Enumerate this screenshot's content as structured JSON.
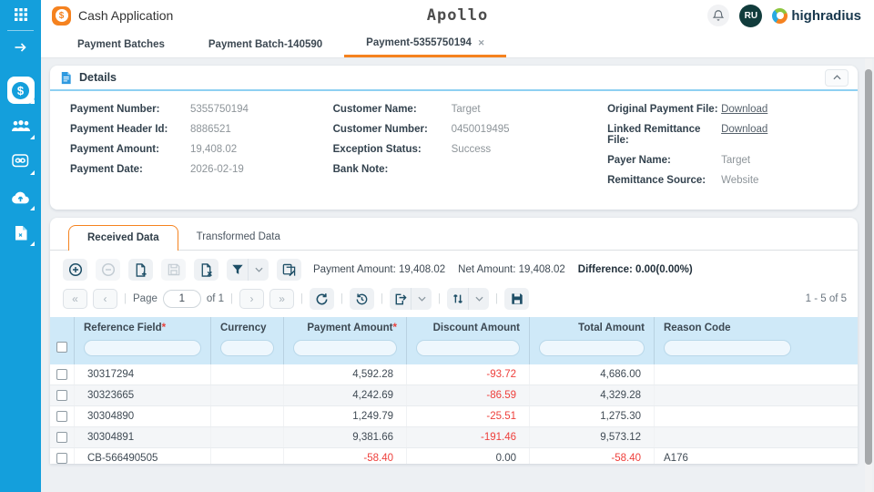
{
  "header": {
    "app_title": "Cash Application",
    "badge_glyph": "$",
    "brand": "Apollo",
    "avatar_initials": "RU",
    "logo_text": "highradius"
  },
  "nav_tabs": {
    "items": [
      {
        "label": "Payment Batches"
      },
      {
        "label": "Payment Batch-140590"
      },
      {
        "label": "Payment-5355750194"
      }
    ],
    "close_glyph": "✕"
  },
  "details": {
    "title": "Details",
    "col1": [
      {
        "label": "Payment Number:",
        "value": "5355750194"
      },
      {
        "label": "Payment Header Id:",
        "value": "8886521"
      },
      {
        "label": "Payment Amount:",
        "value": "19,408.02"
      },
      {
        "label": "Payment Date:",
        "value": "2026-02-19"
      }
    ],
    "col2": [
      {
        "label": "Customer Name:",
        "value": "Target"
      },
      {
        "label": "Customer Number:",
        "value": "0450019495"
      },
      {
        "label": "Exception Status:",
        "value": "Success"
      },
      {
        "label": "Bank Note:",
        "value": ""
      }
    ],
    "col3": [
      {
        "label": "Original Payment File:",
        "value": "Download"
      },
      {
        "label": "Linked Remittance File:",
        "value": "Download"
      },
      {
        "label": "Payer Name:",
        "value": "Target"
      },
      {
        "label": "Remittance Source:",
        "value": "Website"
      }
    ]
  },
  "data_tabs": [
    {
      "label": "Received Data"
    },
    {
      "label": "Transformed Data"
    }
  ],
  "summary": {
    "payment_amount": "Payment Amount: 19,408.02",
    "net_amount": "Net Amount: 19,408.02",
    "difference": "Difference: 0.00(0.00%)"
  },
  "pagination": {
    "first_glyph": "«",
    "prev_glyph": "‹",
    "next_glyph": "›",
    "last_glyph": "»",
    "page_label": "Page",
    "page_value": "1",
    "of_label": "of 1",
    "range_label": "1 - 5 of 5"
  },
  "table": {
    "required_marker": "*",
    "columns": [
      "Reference Field",
      "Currency",
      "Payment Amount",
      "Discount Amount",
      "Total Amount",
      "Reason Code"
    ],
    "rows": [
      {
        "reference": "30317294",
        "currency": "",
        "payment": "4,592.28",
        "discount": "-93.72",
        "total": "4,686.00",
        "reason": ""
      },
      {
        "reference": "30323665",
        "currency": "",
        "payment": "4,242.69",
        "discount": "-86.59",
        "total": "4,329.28",
        "reason": ""
      },
      {
        "reference": "30304890",
        "currency": "",
        "payment": "1,249.79",
        "discount": "-25.51",
        "total": "1,275.30",
        "reason": ""
      },
      {
        "reference": "30304891",
        "currency": "",
        "payment": "9,381.66",
        "discount": "-191.46",
        "total": "9,573.12",
        "reason": ""
      },
      {
        "reference": "CB-566490505",
        "currency": "",
        "payment": "-58.40",
        "discount": "0.00",
        "total": "-58.40",
        "reason": "A176"
      }
    ]
  },
  "colors": {
    "sidebar_blue": "#149fdc",
    "accent_orange": "#f5821f",
    "icon_navy": "#1d4e66",
    "negative_red": "#ee3f3b",
    "table_header_bg": "#cfe9f8"
  }
}
